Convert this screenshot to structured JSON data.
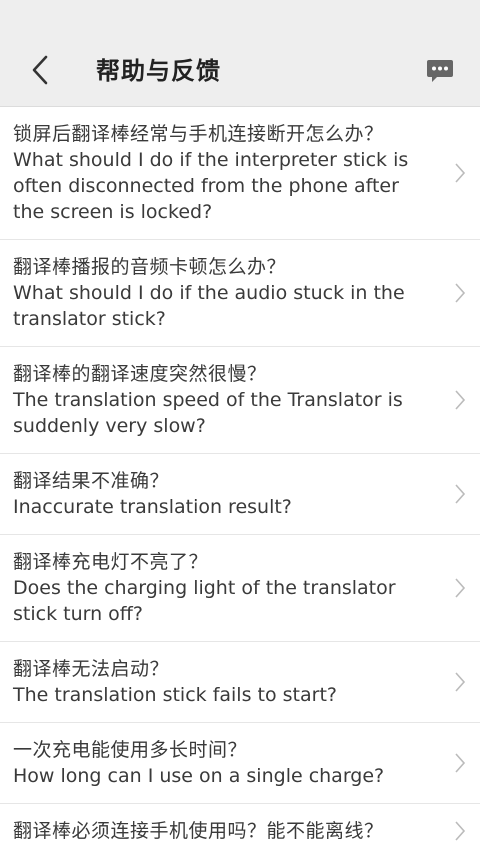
{
  "header": {
    "title": "帮助与反馈",
    "back_icon": "chevron-left-icon",
    "message_icon": "chat-bubble-icon"
  },
  "faq": [
    {
      "cn": "锁屏后翻译棒经常与手机连接断开怎么办？",
      "en": "What should I do if the interpreter stick is often disconnected from the phone after the screen is locked?"
    },
    {
      "cn": "翻译棒播报的音频卡顿怎么办？",
      "en": "What should I do if the audio stuck in the translator stick?"
    },
    {
      "cn": "翻译棒的翻译速度突然很慢？",
      "en": "The translation speed of the Translator is suddenly very slow?"
    },
    {
      "cn": "翻译结果不准确？",
      "en": "Inaccurate translation result?"
    },
    {
      "cn": "翻译棒充电灯不亮了？",
      "en": "Does the charging light of the translator stick turn off?"
    },
    {
      "cn": "翻译棒无法启动？",
      "en": "The translation stick fails to start?"
    },
    {
      "cn": "一次充电能使用多长时间？",
      "en": "How long can I use on a single charge?"
    },
    {
      "cn": "翻译棒必须连接手机使用吗？能不能离线？",
      "en": ""
    }
  ],
  "colors": {
    "header_bg": "#eeeeee",
    "text": "#3a3a3a",
    "chevron": "#bbbbbb",
    "divider": "#e6e6e6"
  }
}
